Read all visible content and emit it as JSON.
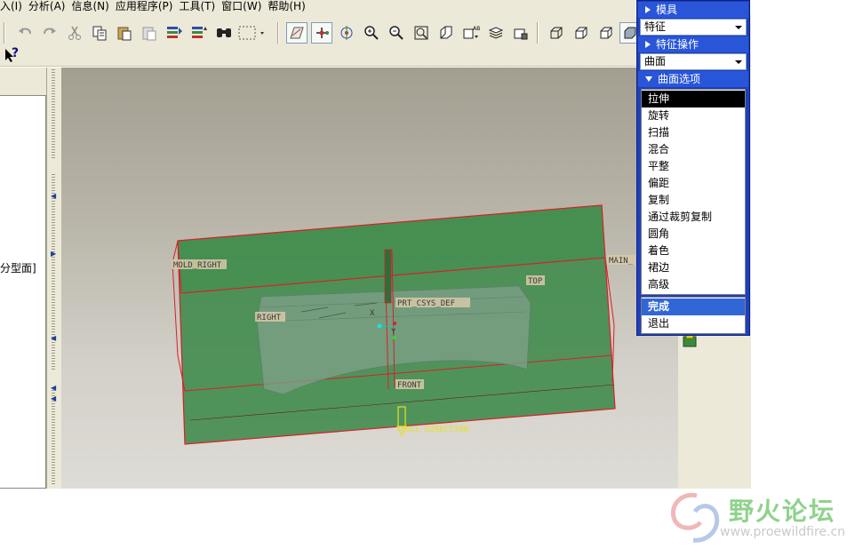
{
  "menubar": {
    "items": [
      "入(I)",
      "分析(A)",
      "信息(N)",
      "应用程序(P)",
      "工具(T)",
      "窗口(W)",
      "帮助(H)"
    ]
  },
  "toolbar": {
    "icons": [
      "undo-icon",
      "redo-icon",
      "cut-icon",
      "copy-icon",
      "paste-icon",
      "paste-special-icon",
      "regenerate-icon",
      "regenerate-manager-icon",
      "find-icon",
      "select-box-icon",
      "datum-plane-display-icon",
      "datum-axis-display-icon",
      "spin-center-icon",
      "zoom-in-icon",
      "zoom-out-icon",
      "refit-icon",
      "reorient-icon",
      "saved-views-icon",
      "layers-icon",
      "view-manager-icon",
      "wireframe-icon",
      "hidden-line-icon",
      "no-hidden-icon",
      "shading-icon"
    ],
    "help_icon": "?"
  },
  "left_panel": {
    "tree_label": "分型面]"
  },
  "viewport": {
    "datum_labels": {
      "mold_right": "MOLD_RIGHT",
      "main": "MAIN_",
      "prt_csys": "PRT_CSYS_DEF",
      "top": "TOP",
      "right": "RIGHT",
      "front": "FRONT",
      "pull_direction": "PULL DIRECTION",
      "axis_x": "X",
      "axis_y": "Y"
    },
    "colors": {
      "mold_block": "#3e8a4a",
      "edge": "#d8202a",
      "part": "#7fa089"
    }
  },
  "menu_manager": {
    "section_mold": "模具",
    "combo_feature": "特征",
    "section_feature_ops": "特征操作",
    "combo_surface": "曲面",
    "section_surface_options": "曲面选项",
    "options": [
      "拉伸",
      "旋转",
      "扫描",
      "混合",
      "平整",
      "偏距",
      "复制",
      "通过裁剪复制",
      "圆角",
      "着色",
      "裙边",
      "高级"
    ],
    "selected_index": 0,
    "done": "完成",
    "exit": "退出"
  },
  "watermark": {
    "title": "野火论坛",
    "url": "www.proewildfire.cn"
  }
}
